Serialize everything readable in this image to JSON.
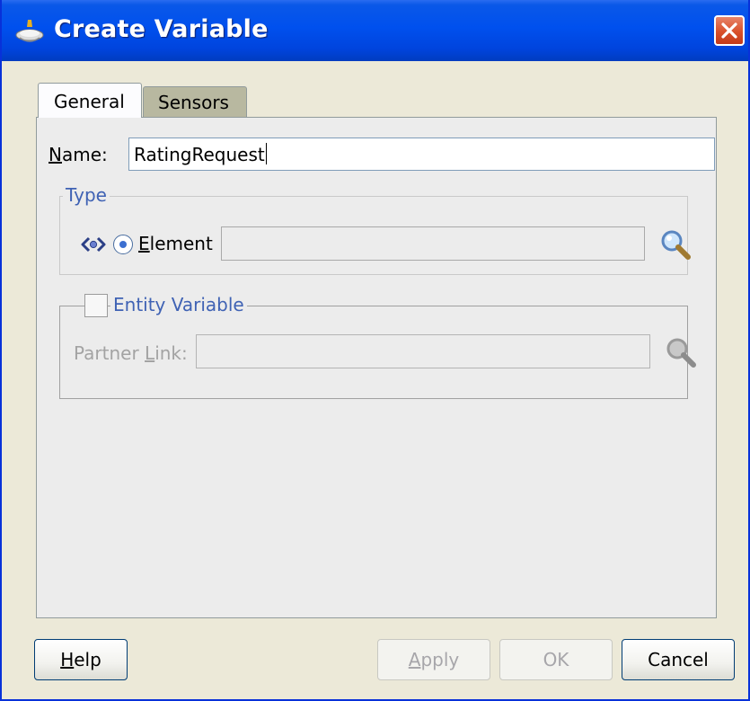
{
  "window": {
    "title": "Create Variable"
  },
  "tabs": [
    {
      "label": "General",
      "active": true
    },
    {
      "label": "Sensors",
      "active": false
    }
  ],
  "name": {
    "label_u": "N",
    "label_rest": "ame:",
    "value": "RatingRequest"
  },
  "type_group": {
    "legend": "Type",
    "element_label_u": "E",
    "element_label_rest": "lement",
    "element_selected": true,
    "element_value": ""
  },
  "entity_group": {
    "legend": "Entity Variable",
    "checked": false,
    "partner_label_pre": "Partner ",
    "partner_label_u": "L",
    "partner_label_post": "ink:",
    "partner_value": ""
  },
  "buttons": {
    "help_u": "H",
    "help_rest": "elp",
    "apply_u": "A",
    "apply_rest": "pply",
    "ok": "OK",
    "cancel": "Cancel"
  },
  "colors": {
    "titlebar": "#0050ee",
    "legend": "#3f62b4",
    "close": "#d9502a"
  },
  "icons": [
    "create-variable-icon",
    "close-icon",
    "element-type-icon",
    "search-icon"
  ]
}
